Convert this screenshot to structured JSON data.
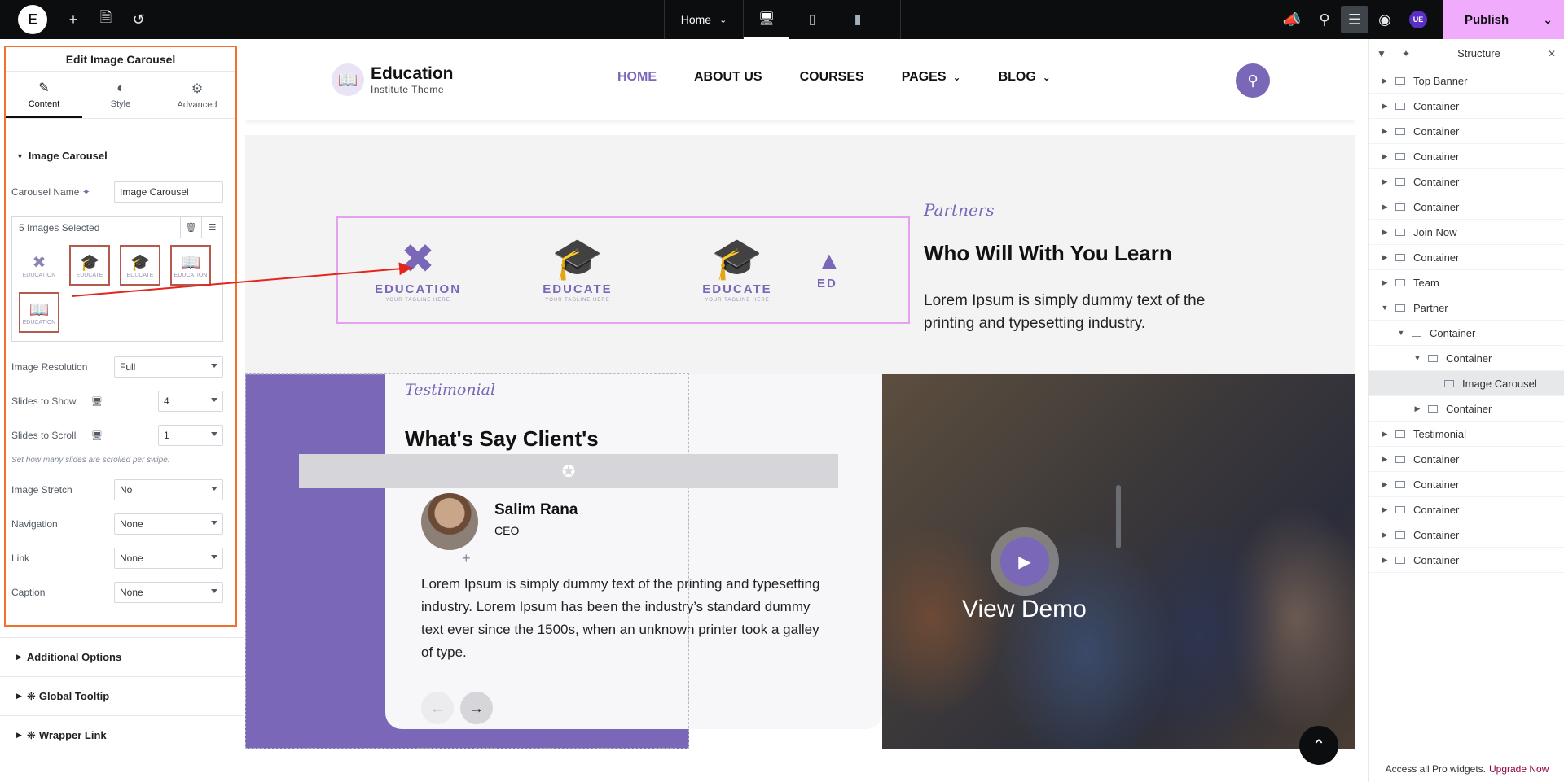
{
  "topbar": {
    "page": "Home",
    "publish": "Publish",
    "avatar": "UE"
  },
  "panel": {
    "title": "Edit Image Carousel",
    "tabs": [
      {
        "label": "Content"
      },
      {
        "label": "Style"
      },
      {
        "label": "Advanced"
      }
    ],
    "section": "Image Carousel",
    "carousel_name_label": "Carousel Name",
    "carousel_name_value": "Image Carousel",
    "gallery_label": "5 Images Selected",
    "thumbs": [
      "EDUCATION",
      "EDUCATE",
      "EDUCATE",
      "EDUCATION",
      "EDUCATION"
    ],
    "controls": [
      {
        "label": "Image Resolution",
        "value": "Full"
      },
      {
        "label": "Slides to Show",
        "value": "4"
      },
      {
        "label": "Slides to Scroll",
        "value": "1"
      },
      {
        "label": "Image Stretch",
        "value": "No"
      },
      {
        "label": "Navigation",
        "value": "None"
      },
      {
        "label": "Link",
        "value": "None"
      },
      {
        "label": "Caption",
        "value": "None"
      }
    ],
    "hint": "Set how many slides are scrolled per swipe.",
    "extras": [
      "Additional Options",
      "Global Tooltip",
      "Wrapper Link"
    ]
  },
  "site": {
    "brand_name": "Education",
    "brand_sub": "Institute Theme",
    "nav": [
      {
        "label": "HOME",
        "dropdown": false
      },
      {
        "label": "ABOUT US",
        "dropdown": false
      },
      {
        "label": "COURSES",
        "dropdown": false
      },
      {
        "label": "PAGES",
        "dropdown": true
      },
      {
        "label": "BLOG",
        "dropdown": true
      }
    ],
    "logos": [
      {
        "name": "EDUCATION",
        "tagline": "YOUR TAGLINE HERE"
      },
      {
        "name": "EDUCATE",
        "tagline": "YOUR TAGLINE HERE"
      },
      {
        "name": "EDUCATE",
        "tagline": "YOUR TAGLINE HERE"
      },
      {
        "name": "ED",
        "tagline": ""
      }
    ],
    "partners_tag": "Partners",
    "partners_title": "Who Will With You Learn",
    "partners_text": "Lorem Ipsum is simply dummy text of the printing and typesetting industry.",
    "testimonial_tag": "Testimonial",
    "testimonial_title": "What's Say Client's",
    "client_name": "Salim Rana",
    "client_role": "CEO",
    "testimonial_text": "Lorem Ipsum is simply dummy text of the printing and typesetting industry. Lorem Ipsum has been the industry’s standard dummy text ever since the 1500s, when an unknown printer took a galley of type.",
    "view_demo": "View Demo"
  },
  "structure": {
    "title": "Structure",
    "items": [
      {
        "label": "Top Banner",
        "depth": 0,
        "open": false
      },
      {
        "label": "Container",
        "depth": 0,
        "open": false
      },
      {
        "label": "Container",
        "depth": 0,
        "open": false
      },
      {
        "label": "Container",
        "depth": 0,
        "open": false
      },
      {
        "label": "Container",
        "depth": 0,
        "open": false
      },
      {
        "label": "Container",
        "depth": 0,
        "open": false
      },
      {
        "label": "Join Now",
        "depth": 0,
        "open": false
      },
      {
        "label": "Container",
        "depth": 0,
        "open": false
      },
      {
        "label": "Team",
        "depth": 0,
        "open": false
      },
      {
        "label": "Partner",
        "depth": 0,
        "open": true
      },
      {
        "label": "Container",
        "depth": 1,
        "open": true
      },
      {
        "label": "Container",
        "depth": 2,
        "open": true
      },
      {
        "label": "Image Carousel",
        "depth": 3,
        "open": null,
        "selected": true
      },
      {
        "label": "Container",
        "depth": 2,
        "open": false
      },
      {
        "label": "Testimonial",
        "depth": 0,
        "open": false
      },
      {
        "label": "Container",
        "depth": 0,
        "open": false
      },
      {
        "label": "Container",
        "depth": 0,
        "open": false
      },
      {
        "label": "Container",
        "depth": 0,
        "open": false
      },
      {
        "label": "Container",
        "depth": 0,
        "open": false
      },
      {
        "label": "Container",
        "depth": 0,
        "open": false
      }
    ],
    "footer_text": "Access all Pro widgets.",
    "footer_link": "Upgrade Now"
  },
  "colors": {
    "accent": "#7a67b8",
    "publish": "#f0abfc",
    "highlight_border": "#f0702c"
  }
}
